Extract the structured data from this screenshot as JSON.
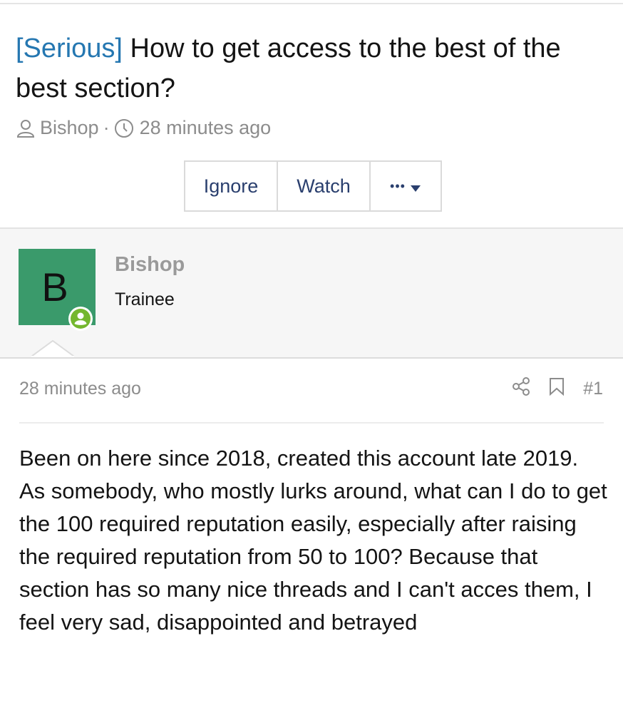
{
  "thread": {
    "prefix": "[Serious]",
    "title": "How to get access to the best of the best section?",
    "author": "Bishop",
    "separator": "·",
    "time": "28 minutes ago"
  },
  "actions": {
    "ignore_label": "Ignore",
    "watch_label": "Watch",
    "more_label": "•••"
  },
  "author_panel": {
    "avatar_letter": "B",
    "name": "Bishop",
    "user_title": "Trainee",
    "avatar_color": "#3a9a6b",
    "online_color": "#74b72e"
  },
  "post": {
    "time": "28 minutes ago",
    "number": "#1",
    "lines": [
      "Been on here since 2018, created this account late 2019.",
      "As somebody, who mostly lurks around, what can I do to get the 100 required reputation easily, especially after raising the required reputation from 50 to 100? Because that section has so many nice threads and I can't acces them, I feel very sad, disappointed and betrayed"
    ]
  },
  "icons": {
    "author": "user-icon",
    "time": "clock-icon",
    "more": "caret-down-icon",
    "share": "share-icon",
    "bookmark": "bookmark-icon"
  },
  "colors": {
    "link": "#2577b1",
    "button_text": "#2a3f6e",
    "muted": "#8c8c8c"
  }
}
